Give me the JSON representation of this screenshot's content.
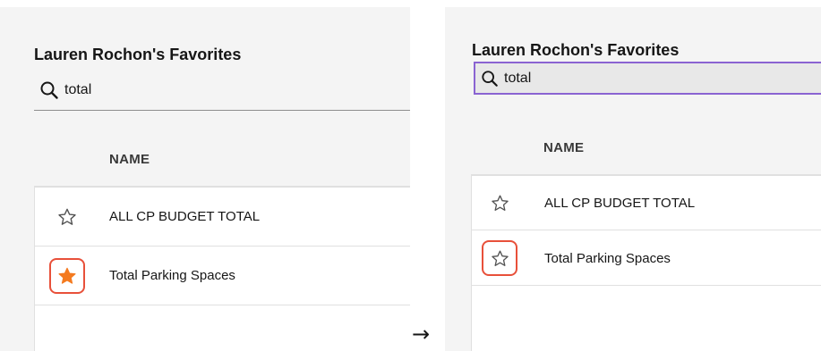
{
  "before": {
    "title": "Lauren Rochon's Favorites",
    "search": {
      "value": "total",
      "icon": "search-icon"
    },
    "column_header": "NAME",
    "rows": [
      {
        "label": "ALL CP BUDGET TOTAL",
        "favorited": false,
        "icon": "star-outline-icon"
      },
      {
        "label": "Total Parking Spaces",
        "favorited": true,
        "icon": "star-filled-icon",
        "highlighted": true
      }
    ]
  },
  "after": {
    "title": "Lauren Rochon's Favorites",
    "search": {
      "value": "total",
      "icon": "search-icon",
      "focused": true
    },
    "column_header": "NAME",
    "rows": [
      {
        "label": "ALL CP BUDGET TOTAL",
        "favorited": false,
        "icon": "star-outline-icon"
      },
      {
        "label": "Total Parking Spaces",
        "favorited": false,
        "icon": "star-outline-icon",
        "highlighted": true
      }
    ]
  },
  "transition_arrow": "→",
  "colors": {
    "star_filled": "#f47a1f",
    "highlight_border": "#e8503a",
    "focus_border": "#8a63d2",
    "panel_bg": "#f4f4f4"
  }
}
